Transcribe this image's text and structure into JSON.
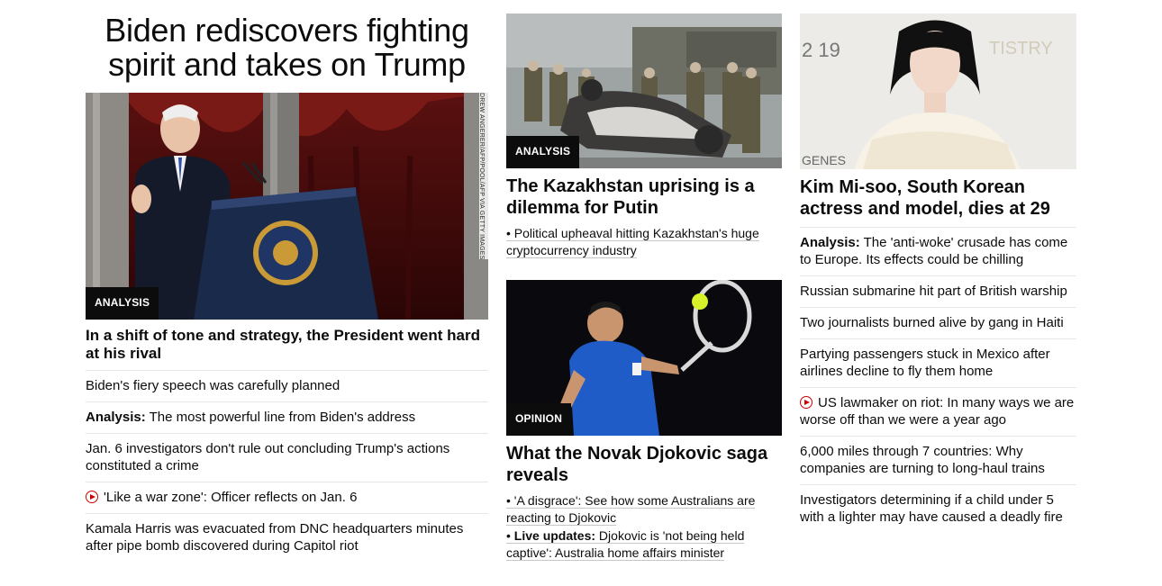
{
  "lead": {
    "headline": "Biden rediscovers fighting spirit and takes on Trump",
    "label": "ANALYSIS",
    "credit": "DREW ANGERER/AFP/POOL/AFP VIA GETTY IMAGES",
    "image_icon": "president-at-podium-photo",
    "title": "In a shift of tone and strategy, the President went hard at his rival",
    "links": [
      {
        "prefix": "",
        "text": "Biden's fiery speech was carefully planned",
        "video": false
      },
      {
        "prefix": "Analysis:",
        "text": " The most powerful line from Biden's address",
        "video": false
      },
      {
        "prefix": "",
        "text": "Jan. 6 investigators don't rule out concluding Trump's actions constituted a crime",
        "video": false
      },
      {
        "prefix": "",
        "text": "'Like a war zone': Officer reflects on Jan. 6",
        "video": true
      },
      {
        "prefix": "",
        "text": "Kamala Harris was evacuated from DNC headquarters minutes after pipe bomb discovered during Capitol riot",
        "video": false
      }
    ]
  },
  "kazakhstan": {
    "label": "ANALYSIS",
    "image_icon": "soldiers-burned-car-photo",
    "title": "The Kazakhstan uprising is a dilemma for Putin",
    "subs": [
      {
        "prefix": "• ",
        "bold": "",
        "text": "Political upheaval hitting Kazakhstan's huge cryptocurrency industry"
      }
    ]
  },
  "djokovic": {
    "label": "OPINION",
    "image_icon": "tennis-player-photo",
    "title": "What the Novak Djokovic saga reveals",
    "subs": [
      {
        "prefix": "• ",
        "bold": "",
        "text": "'A disgrace': See how some Australians are reacting to Djokovic"
      },
      {
        "prefix": "• ",
        "bold": "Live updates:",
        "text": " Djokovic is 'not being held captive': Australia home affairs minister"
      }
    ]
  },
  "kim": {
    "image_icon": "actress-portrait-photo",
    "backdrop_text": "2 19",
    "backdrop_text2": "TISTRY",
    "backdrop_text3": "GENES",
    "title": "Kim Mi-soo, South Korean actress and model, dies at 29",
    "links": [
      {
        "prefix": "Analysis:",
        "text": " The 'anti-woke' crusade has come to Europe. Its effects could be chilling",
        "video": false
      },
      {
        "prefix": "",
        "text": "Russian submarine hit part of British warship",
        "video": false
      },
      {
        "prefix": "",
        "text": "Two journalists burned alive by gang in Haiti",
        "video": false
      },
      {
        "prefix": "",
        "text": "Partying passengers stuck in Mexico after airlines decline to fly them home",
        "video": false
      },
      {
        "prefix": "",
        "text": "US lawmaker on riot: In many ways we are worse off than we were a year ago",
        "video": true
      },
      {
        "prefix": "",
        "text": "6,000 miles through 7 countries: Why companies are turning to long-haul trains",
        "video": false
      },
      {
        "prefix": "",
        "text": "Investigators determining if a child under 5 with a lighter may have caused a deadly fire",
        "video": false
      }
    ]
  },
  "colors": {
    "accent_red": "#cc0000",
    "label_bg": "#0c0c0c",
    "divider": "#e6e6e6"
  }
}
